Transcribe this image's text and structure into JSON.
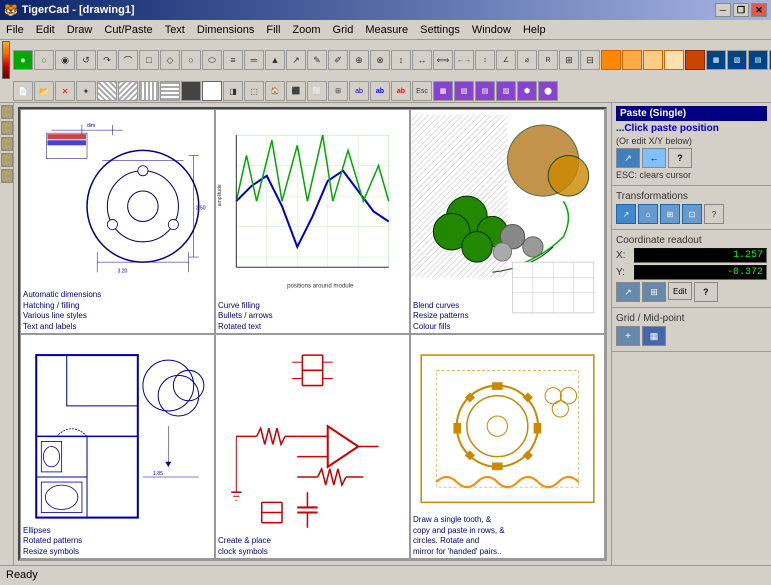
{
  "window": {
    "title": "TigerCad - [drawing1]",
    "icon": "🐯"
  },
  "titlebar": {
    "minimize": "─",
    "maximize": "□",
    "restore": "❐",
    "close": "✕"
  },
  "menu": {
    "items": [
      "File",
      "Edit",
      "Draw",
      "Cut/Paste",
      "Text",
      "Dimensions",
      "Fill",
      "Zoom",
      "Grid",
      "Measure",
      "Settings",
      "Window",
      "Help"
    ]
  },
  "toolbar": {
    "row1": [
      "●",
      "○",
      "◉",
      "↺",
      "↷",
      "⌒",
      "□",
      "◇",
      "○",
      "⬭",
      "≡",
      "═",
      "▲",
      "↗",
      "✎",
      "✐",
      "⊕",
      "⊗",
      "↕",
      "↔",
      "⟺",
      "♦",
      "★",
      "♦",
      "♠",
      "♣",
      "⊞",
      "⊟",
      "⊠",
      "⊡",
      "⊞",
      "⊟",
      "⊠"
    ],
    "row2": [
      "⊕",
      "✕",
      "✦",
      "◨",
      "⊞",
      "▦",
      "◈",
      "▣",
      "▥",
      "▤",
      "▧",
      "▨",
      "▩",
      "⬚",
      "⬛",
      "⬜",
      "⊡",
      "▬",
      "▭",
      "▮",
      "▯",
      "▰",
      "▱",
      "⬟",
      "⬠",
      "⬡",
      "⬢",
      "⬣",
      "⬤",
      "⬥",
      "⬦",
      "⬧",
      "⬨"
    ]
  },
  "right_panel": {
    "paste_title": "Paste (Single)",
    "paste_subtitle": "...Click paste position",
    "paste_note": "(Or edit X/Y below)",
    "paste_esc": "ESC: clears cursor",
    "transformations_title": "Transformations",
    "coord_title": "Coordinate readout",
    "coord_x_label": "X:",
    "coord_x_value": "1.257",
    "coord_y_label": "Y:",
    "coord_y_value": "-0.372",
    "edit_label": "Edit",
    "grid_title": "Grid / Mid-point",
    "trans_icons": [
      "↗",
      "⌂",
      "⊞",
      "⊡",
      "?"
    ],
    "coord_icons": [
      "↗",
      "⊞",
      "Edit",
      "?"
    ]
  },
  "cells": [
    {
      "id": "cell-1",
      "captions": [
        "Automatic dimensions",
        "Hatching / filling",
        "Various line styles",
        "Text and labels"
      ]
    },
    {
      "id": "cell-2",
      "captions": [
        "Curve filling",
        "Bullets / arrows",
        "Rotated text"
      ]
    },
    {
      "id": "cell-3",
      "captions": [
        "Blend curves",
        "Resize patterns",
        "Colour fills"
      ]
    },
    {
      "id": "cell-4",
      "captions": [
        "Ellipses",
        "Rotated patterns",
        "Resize symbols"
      ]
    },
    {
      "id": "cell-5",
      "captions": [
        "Create & place",
        "clock symbols"
      ]
    },
    {
      "id": "cell-6",
      "captions": [
        "Draw a single tooth, &",
        "copy and paste in rows, &",
        "circles. Rotate and",
        "mirror for 'handed' pairs.."
      ]
    }
  ],
  "status": {
    "text": "Ready"
  }
}
